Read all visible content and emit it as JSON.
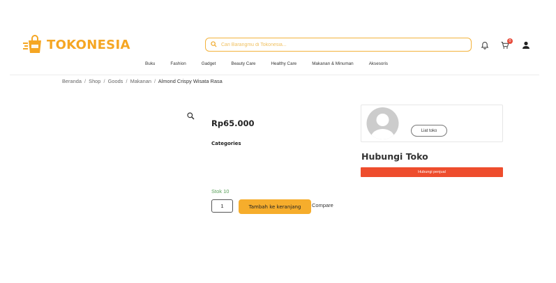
{
  "brand": {
    "name": "TOKONESIA",
    "color": "#f5a623",
    "icon": "shopping-bag-icon"
  },
  "search": {
    "placeholder": "Cari Barangmu di Tokonesia...",
    "icon": "search-icon"
  },
  "header_icons": {
    "notifications": "bell-icon",
    "cart": "cart-icon",
    "cart_count": "0",
    "account": "user-icon"
  },
  "nav": {
    "items": [
      {
        "label": "Buku"
      },
      {
        "label": "Fashion"
      },
      {
        "label": "Gadget"
      },
      {
        "label": "Beauty Care"
      },
      {
        "label": "Healthy Care"
      },
      {
        "label": "Makanan & Minuman"
      },
      {
        "label": "Aksesoris"
      }
    ]
  },
  "breadcrumb": {
    "items": [
      "Beranda",
      "Shop",
      "Goods",
      "Makanan"
    ],
    "separator": "/",
    "current": "Almond Crispy Wisata Rasa"
  },
  "product": {
    "price": "Rp65.000",
    "categories_label": "Categories",
    "stock": "Stok 10",
    "quantity": "1",
    "add_to_cart_label": "Tambah ke keranjang",
    "compare_label": "Compare",
    "zoom_icon": "magnifier-icon",
    "stock_color": "#5aa05a",
    "button_color": "#f6ad2c"
  },
  "store": {
    "visit_label": "Liat toko",
    "contact_title": "Hubungi Toko",
    "contact_button": "Hubungi penjual",
    "contact_color": "#ee4d2d",
    "avatar_icon": "avatar-placeholder-icon"
  }
}
